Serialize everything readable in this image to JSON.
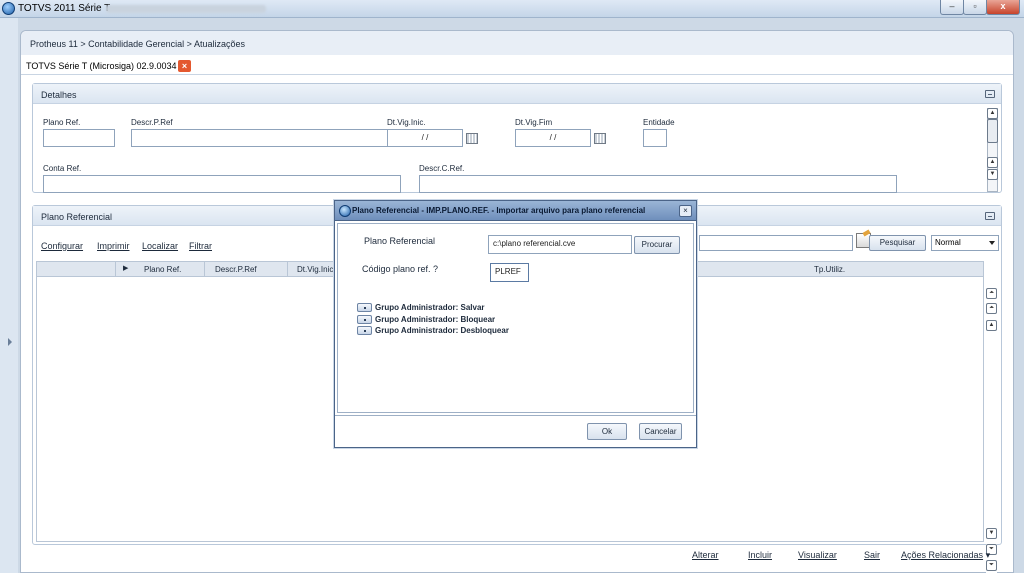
{
  "window": {
    "title": "TOTVS 2011 Série T",
    "min_glyph": "–",
    "max_glyph": "▫",
    "close_glyph": "x"
  },
  "breadcrumb": "Protheus 11 > Contabilidade Gerencial > Atualizações",
  "tab": {
    "label": "TOTVS Série T  (Microsiga) 02.9.0034",
    "close_glyph": "×"
  },
  "detalhes": {
    "title": "Detalhes",
    "fields": {
      "plano_ref": {
        "label": "Plano Ref.",
        "value": ""
      },
      "descr_pref": {
        "label": "Descr.P.Ref",
        "value": ""
      },
      "dt_vig_inic": {
        "label": "Dt.Vig.Inic.",
        "value": " / /"
      },
      "dt_vig_fim": {
        "label": "Dt.Vig.Fim",
        "value": " / /"
      },
      "entidade": {
        "label": "Entidade",
        "value": ""
      },
      "conta_ref": {
        "label": "Conta Ref.",
        "value": ""
      },
      "descr_cref": {
        "label": "Descr.C.Ref.",
        "value": ""
      }
    }
  },
  "plano_panel": {
    "title": "Plano Referencial",
    "links": [
      "Configurar",
      "Imprimir",
      "Localizar",
      "Filtrar"
    ],
    "search_button": "Pesquisar",
    "search_mode": "Normal",
    "grid_columns": [
      "Plano Ref.",
      "Descr.P.Ref",
      "Dt.Vig.Inic",
      "Tp.Utiliz."
    ]
  },
  "actions": [
    "Alterar",
    "Incluir",
    "Visualizar",
    "Sair",
    "Ações Relacionadas"
  ],
  "dialog": {
    "title": "Plano Referencial - IMP.PLANO.REF. - Importar arquivo para plano referencial",
    "close_glyph": "×",
    "file_label": "Plano Referencial",
    "file_value": "c:\\plano referencial.cve",
    "browse_button": "Procurar",
    "code_label": "Código plano ref. ?",
    "code_value": "PLREF",
    "groups": [
      "Grupo Administrador: Salvar",
      "Grupo Administrador: Bloquear",
      "Grupo Administrador: Desbloquear"
    ],
    "ok_button": "Ok",
    "cancel_button": "Cancelar"
  }
}
